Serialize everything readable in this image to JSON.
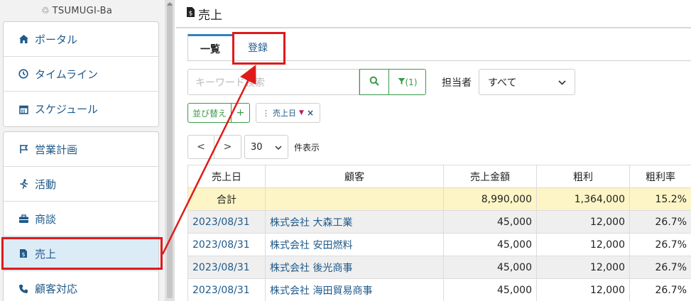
{
  "sidebar": {
    "logo_text": "TSUMUGI-Ba",
    "group1": [
      {
        "icon": "home-icon",
        "label": "ポータル"
      },
      {
        "icon": "clock-icon",
        "label": "タイムライン"
      },
      {
        "icon": "calendar-icon",
        "label": "スケジュール"
      }
    ],
    "group2": [
      {
        "icon": "flag-icon",
        "label": "営業計画"
      },
      {
        "icon": "running-icon",
        "label": "活動"
      },
      {
        "icon": "briefcase-icon",
        "label": "商談"
      },
      {
        "icon": "invoice-icon",
        "label": "売上",
        "active": true
      },
      {
        "icon": "phone-icon",
        "label": "顧客対応"
      }
    ]
  },
  "page": {
    "title": "売上"
  },
  "tabs": {
    "list": "一覧",
    "register": "登録"
  },
  "search": {
    "placeholder": "キーワード検索",
    "filter_count": "(1)",
    "assignee_label": "担当者",
    "assignee_value": "すべて"
  },
  "sort": {
    "sort_button": "並び替え",
    "plus": "+",
    "chip_label": "売上日",
    "chip_direction": "▼",
    "chip_remove": "×"
  },
  "pagination": {
    "prev": "<",
    "next": ">",
    "per_page": "30",
    "per_page_suffix": "件表示"
  },
  "table": {
    "headers": [
      "売上日",
      "顧客",
      "売上金額",
      "粗利",
      "粗利率"
    ],
    "total": {
      "label": "合計",
      "amount": "8,990,000",
      "profit": "1,364,000",
      "rate": "15.2%"
    },
    "rows": [
      {
        "date": "2023/08/31",
        "customer": "株式会社 大森工業",
        "amount": "45,000",
        "profit": "12,000",
        "rate": "26.7%"
      },
      {
        "date": "2023/08/31",
        "customer": "株式会社 安田燃料",
        "amount": "45,000",
        "profit": "12,000",
        "rate": "26.7%"
      },
      {
        "date": "2023/08/31",
        "customer": "株式会社 後光商事",
        "amount": "45,000",
        "profit": "12,000",
        "rate": "26.7%"
      },
      {
        "date": "2023/08/31",
        "customer": "株式会社 海田貿易商事",
        "amount": "45,000",
        "profit": "12,000",
        "rate": "26.7%"
      }
    ]
  },
  "colors": {
    "accent": "#1f5a8a",
    "green": "#3a9a4a",
    "annotation_red": "#e01a1a",
    "total_row": "#fdf5c6",
    "active_nav": "#dcecf7"
  }
}
